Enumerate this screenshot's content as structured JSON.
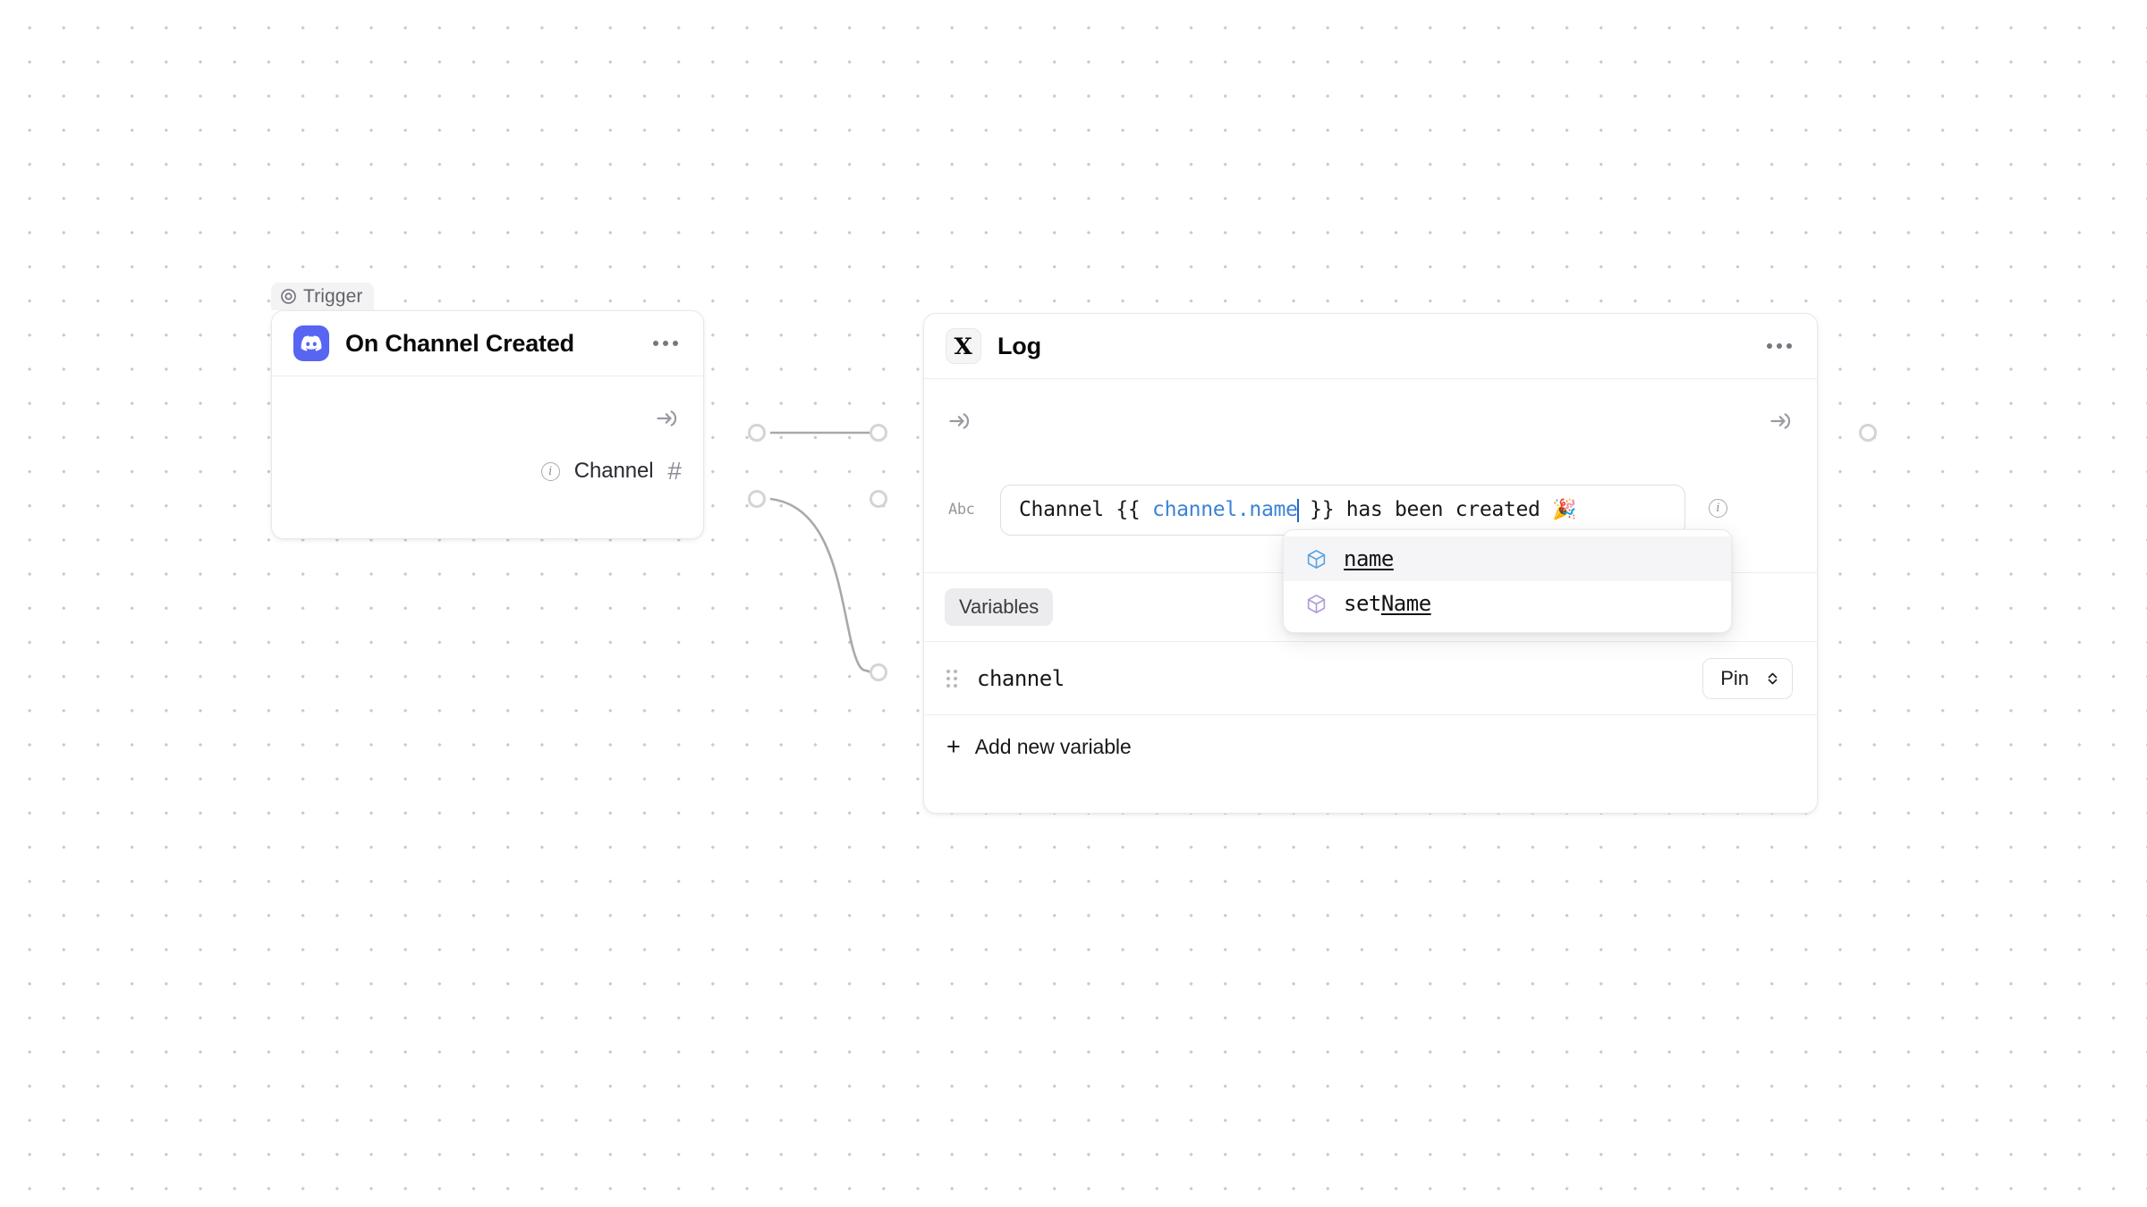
{
  "canvas": {
    "background_color": "#ffffff",
    "dot_color": "#c9c9cf"
  },
  "trigger_node": {
    "tab_label": "Trigger",
    "tab_icon": "target-icon",
    "app_icon": "discord-icon",
    "app_icon_color": "#5865f2",
    "title": "On Channel Created",
    "menu_icon": "ellipsis-icon",
    "input_port_icon": "arrow-into-icon",
    "field": {
      "info_icon": "info-icon",
      "label": "Channel",
      "type_icon": "hash-icon"
    }
  },
  "log_node": {
    "app_icon": "x-logo-icon",
    "title": "Log",
    "menu_icon": "ellipsis-icon",
    "input_port_icon": "arrow-into-icon",
    "output_port_icon": "arrow-into-icon",
    "message_field": {
      "type_label": "Abc",
      "text_before": "Channel {{ ",
      "variable": "channel.name",
      "text_after": " }} has been created ",
      "emoji": "🎉",
      "full_value": "Channel {{ channel.name }} has been created 🎉",
      "info_icon": "info-icon",
      "variable_color": "#3b82d6",
      "caret_color": "#2563c9"
    },
    "autocomplete": {
      "items": [
        {
          "label": "name",
          "underline": "name",
          "icon": "cube-icon",
          "icon_color": "#5ba4e0",
          "selected": true
        },
        {
          "label": "setName",
          "underline": "Name",
          "prefix": "set",
          "icon": "cube-icon",
          "icon_color": "#b09cd8",
          "selected": false
        }
      ]
    },
    "tabs": [
      {
        "label": "Variables",
        "active": true
      }
    ],
    "variables": [
      {
        "drag_handle_icon": "drag-dots-icon",
        "name": "channel",
        "mode": "Pin",
        "mode_icon": "chevron-up-down-icon"
      }
    ],
    "add_variable": {
      "icon": "plus-icon",
      "label": "Add new variable"
    }
  },
  "connections": {
    "port_border_color": "#d4d4d8",
    "edge_color": "#9c9ca4"
  }
}
